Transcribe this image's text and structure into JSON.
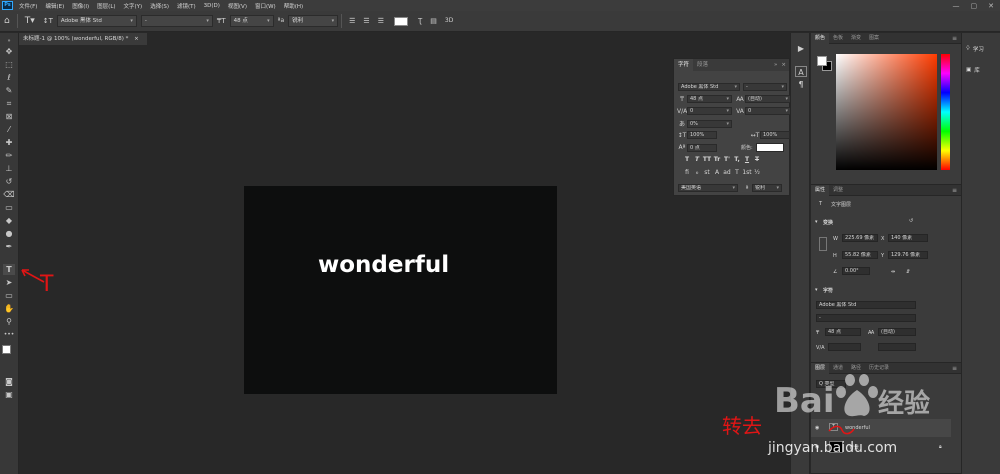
{
  "menubar": {
    "logo": "Ps",
    "items": [
      "文件(F)",
      "编辑(E)",
      "图像(I)",
      "图层(L)",
      "文字(Y)",
      "选择(S)",
      "滤镜(T)",
      "3D(D)",
      "视图(V)",
      "窗口(W)",
      "帮助(H)"
    ],
    "window_controls": [
      "—",
      "▢",
      "✕"
    ]
  },
  "options": {
    "font_family": "Adobe 黑体 Std",
    "font_style": "-",
    "font_size": "48 点",
    "aa_mode": "锐利",
    "label_3d": "3D"
  },
  "document_tab": {
    "label": "未标题-1 @ 100% (wonderful, RGB/8) *"
  },
  "canvas": {
    "text": "wonderful",
    "background_color": "#0d0e0e"
  },
  "annotations": {
    "tool_letter": "T",
    "chinese_note": "转去"
  },
  "character_panel": {
    "tabs": [
      "字符",
      "段落"
    ],
    "font_family": "Adobe 黑体 Std",
    "font_style": "-",
    "font_size": "48 点",
    "leading": "(自动)",
    "kerning": "0",
    "tracking": "0",
    "tsume": "0%",
    "vertical_scale": "100%",
    "horizontal_scale": "100%",
    "baseline_shift": "0 点",
    "color_label": "颜色:",
    "styles": [
      "T",
      "T",
      "TT",
      "Tr",
      "T'",
      "T,",
      "T",
      "T"
    ],
    "opentype": [
      "fi",
      "ℴ",
      "st",
      "A",
      "ad",
      "T",
      "1st",
      "½"
    ],
    "language": "美国英语",
    "aa_mode": "锐利",
    "aa_icon": "ª"
  },
  "color_panel": {
    "tabs": [
      "颜色",
      "色板",
      "渐变",
      "图案"
    ],
    "foreground": "#ffffff",
    "background": "#000000"
  },
  "properties_panel": {
    "tabs": [
      "属性",
      "调整"
    ],
    "layer_type": "文字图层",
    "transform_title": "变换",
    "w_label": "W",
    "w_value": "225.69 像素",
    "x_label": "X",
    "x_value": "140 像素",
    "h_label": "H",
    "h_value": "55.82 像素",
    "y_label": "Y",
    "y_value": "129.76 像素",
    "angle_value": "0.00°",
    "char_title": "字符",
    "font_family": "Adobe 黑体 Std",
    "font_style": "-",
    "font_size": "48 点",
    "leading": "(自动)",
    "tracking_label": "V/A"
  },
  "layers_panel": {
    "tabs": [
      "图层",
      "通道",
      "路径",
      "历史记录"
    ],
    "kind_label": "Q 类型",
    "layers": [
      {
        "name": "wonderful",
        "type": "T"
      },
      {
        "name": "背景",
        "type": "bg"
      }
    ]
  },
  "learn_strip": {
    "items": [
      "学习",
      "库"
    ]
  },
  "watermark": {
    "brand": "Bai 经验",
    "url": "jingyan.baidu.com"
  }
}
